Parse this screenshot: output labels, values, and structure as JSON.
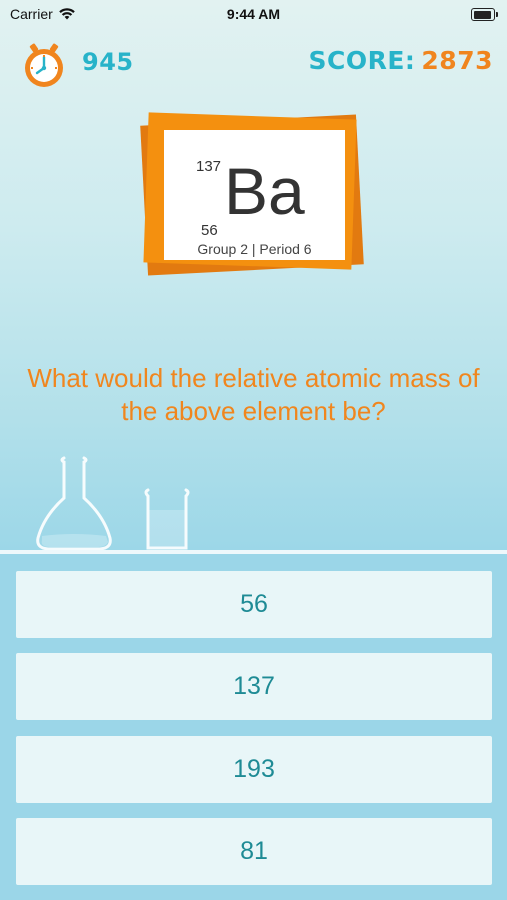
{
  "status_bar": {
    "carrier": "Carrier",
    "time": "9:44 AM",
    "icons": [
      "wifi-icon",
      "battery-icon"
    ]
  },
  "header": {
    "timer_value": "945",
    "timer_icon": "stopwatch-icon",
    "score_label": "SCORE:",
    "score_value": "2873"
  },
  "element_card": {
    "mass_number": "137",
    "atomic_number": "56",
    "symbol": "Ba",
    "group_period": "Group 2 | Period 6"
  },
  "question": {
    "text": "What would the relative atomic mass of the above element be?"
  },
  "answers": [
    {
      "label": "56"
    },
    {
      "label": "137"
    },
    {
      "label": "193"
    },
    {
      "label": "81"
    }
  ],
  "colors": {
    "accent_teal": "#27b3c9",
    "accent_orange": "#f0851e",
    "answer_text": "#1e8b95",
    "answer_bg": "#e8f6f8",
    "panel_bg": "#9bd6e8"
  }
}
